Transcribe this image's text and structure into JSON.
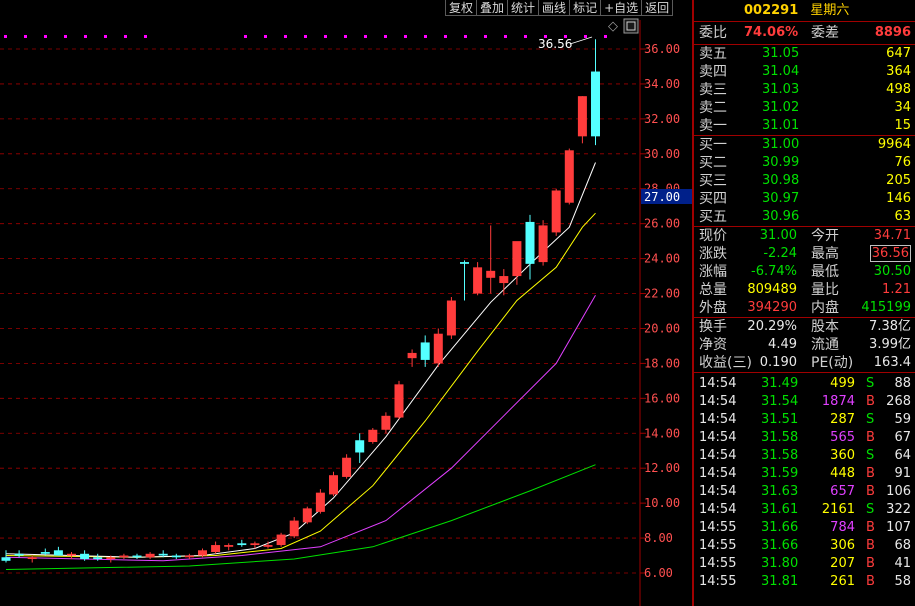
{
  "toolbar": {
    "buttons": [
      "复权",
      "叠加",
      "统计",
      "画线",
      "标记",
      "+自选",
      "返回"
    ]
  },
  "header": {
    "code": "002291",
    "name": "星期六"
  },
  "price_axis": {
    "ticks": [
      "36.00",
      "34.00",
      "32.00",
      "30.00",
      "28.00",
      "26.00",
      "24.00",
      "22.00",
      "20.00",
      "18.00",
      "16.00",
      "14.00",
      "12.00",
      "10.00",
      "8.00",
      "6.00"
    ],
    "current_price_tag": "27.00"
  },
  "chart_annotation": {
    "high_label": "36.56",
    "marker": "◇"
  },
  "colors": {
    "up": "#ff3c3c",
    "down": "#54ffff",
    "ma5": "#ffffff",
    "ma10": "#ffff00",
    "ma20": "#e040ff",
    "ma60": "#00e000",
    "grid": "#a00000"
  },
  "quote": {
    "weibi_label": "委比",
    "weibi_value": "74.06%",
    "weicha_label": "委差",
    "weicha_value": "8896",
    "asks": [
      {
        "label": "卖五",
        "price": "31.05",
        "vol": "647"
      },
      {
        "label": "卖四",
        "price": "31.04",
        "vol": "364"
      },
      {
        "label": "卖三",
        "price": "31.03",
        "vol": "498"
      },
      {
        "label": "卖二",
        "price": "31.02",
        "vol": "34"
      },
      {
        "label": "卖一",
        "price": "31.01",
        "vol": "15"
      }
    ],
    "bids": [
      {
        "label": "买一",
        "price": "31.00",
        "vol": "9964"
      },
      {
        "label": "买二",
        "price": "30.99",
        "vol": "76"
      },
      {
        "label": "买三",
        "price": "30.98",
        "vol": "205"
      },
      {
        "label": "买四",
        "price": "30.97",
        "vol": "146"
      },
      {
        "label": "买五",
        "price": "30.96",
        "vol": "63"
      }
    ],
    "stats": [
      {
        "l1": "现价",
        "v1": "31.00",
        "l2": "今开",
        "v2": "34.71"
      },
      {
        "l1": "涨跌",
        "v1": "-2.24",
        "l2": "最高",
        "v2": "36.56"
      },
      {
        "l1": "涨幅",
        "v1": "-6.74%",
        "l2": "最低",
        "v2": "30.50"
      },
      {
        "l1": "总量",
        "v1": "809489",
        "l2": "量比",
        "v2": "1.21"
      },
      {
        "l1": "外盘",
        "v1": "394290",
        "l2": "内盘",
        "v2": "415199"
      }
    ],
    "fund": [
      {
        "l1": "换手",
        "v1": "20.29%",
        "l2": "股本",
        "v2": "7.38亿"
      },
      {
        "l1": "净资",
        "v1": "4.49",
        "l2": "流通",
        "v2": "3.99亿"
      },
      {
        "l1": "收益(三)",
        "v1": "0.190",
        "l2": "PE(动)",
        "v2": "163.4"
      }
    ]
  },
  "ticks": [
    {
      "time": "14:54",
      "price": "31.49",
      "vol": "499",
      "side": "S",
      "count": "88"
    },
    {
      "time": "14:54",
      "price": "31.54",
      "vol": "1874",
      "side": "B",
      "count": "268"
    },
    {
      "time": "14:54",
      "price": "31.51",
      "vol": "287",
      "side": "S",
      "count": "59"
    },
    {
      "time": "14:54",
      "price": "31.58",
      "vol": "565",
      "side": "B",
      "count": "67"
    },
    {
      "time": "14:54",
      "price": "31.58",
      "vol": "360",
      "side": "S",
      "count": "64"
    },
    {
      "time": "14:54",
      "price": "31.59",
      "vol": "448",
      "side": "B",
      "count": "91"
    },
    {
      "time": "14:54",
      "price": "31.63",
      "vol": "657",
      "side": "B",
      "count": "106"
    },
    {
      "time": "14:54",
      "price": "31.61",
      "vol": "2161",
      "side": "S",
      "count": "322"
    },
    {
      "time": "14:55",
      "price": "31.66",
      "vol": "784",
      "side": "B",
      "count": "107"
    },
    {
      "time": "14:55",
      "price": "31.66",
      "vol": "306",
      "side": "B",
      "count": "68"
    },
    {
      "time": "14:55",
      "price": "31.80",
      "vol": "207",
      "side": "B",
      "count": "41"
    },
    {
      "time": "14:55",
      "price": "31.81",
      "vol": "261",
      "side": "B",
      "count": "58"
    }
  ],
  "chart_data": {
    "type": "candlestick",
    "ylim": [
      5.5,
      38
    ],
    "candles": [
      {
        "o": 6.9,
        "h": 7.3,
        "l": 6.6,
        "c": 6.7
      },
      {
        "o": 7.1,
        "h": 7.3,
        "l": 6.9,
        "c": 7.0
      },
      {
        "o": 6.8,
        "h": 7.0,
        "l": 6.6,
        "c": 6.9
      },
      {
        "o": 7.2,
        "h": 7.4,
        "l": 7.0,
        "c": 7.1
      },
      {
        "o": 7.3,
        "h": 7.5,
        "l": 7.0,
        "c": 7.0
      },
      {
        "o": 7.0,
        "h": 7.2,
        "l": 6.8,
        "c": 7.1
      },
      {
        "o": 7.1,
        "h": 7.3,
        "l": 6.7,
        "c": 6.8
      },
      {
        "o": 6.9,
        "h": 7.1,
        "l": 6.7,
        "c": 6.8
      },
      {
        "o": 6.8,
        "h": 7.0,
        "l": 6.6,
        "c": 6.9
      },
      {
        "o": 6.9,
        "h": 7.1,
        "l": 6.8,
        "c": 7.0
      },
      {
        "o": 7.0,
        "h": 7.1,
        "l": 6.8,
        "c": 6.9
      },
      {
        "o": 6.9,
        "h": 7.2,
        "l": 6.8,
        "c": 7.1
      },
      {
        "o": 7.1,
        "h": 7.3,
        "l": 6.9,
        "c": 7.0
      },
      {
        "o": 7.0,
        "h": 7.1,
        "l": 6.8,
        "c": 6.9
      },
      {
        "o": 6.9,
        "h": 7.1,
        "l": 6.8,
        "c": 7.0
      },
      {
        "o": 7.0,
        "h": 7.4,
        "l": 6.9,
        "c": 7.3
      },
      {
        "o": 7.2,
        "h": 7.8,
        "l": 7.1,
        "c": 7.6
      },
      {
        "o": 7.5,
        "h": 7.7,
        "l": 7.3,
        "c": 7.6
      },
      {
        "o": 7.7,
        "h": 7.9,
        "l": 7.5,
        "c": 7.6
      },
      {
        "o": 7.6,
        "h": 7.8,
        "l": 7.4,
        "c": 7.7
      },
      {
        "o": 7.5,
        "h": 7.8,
        "l": 7.4,
        "c": 7.6
      },
      {
        "o": 7.6,
        "h": 8.3,
        "l": 7.5,
        "c": 8.2
      },
      {
        "o": 8.1,
        "h": 9.2,
        "l": 8.0,
        "c": 9.0
      },
      {
        "o": 8.9,
        "h": 9.8,
        "l": 8.8,
        "c": 9.7
      },
      {
        "o": 9.5,
        "h": 10.8,
        "l": 9.4,
        "c": 10.6
      },
      {
        "o": 10.5,
        "h": 11.8,
        "l": 10.4,
        "c": 11.6
      },
      {
        "o": 11.5,
        "h": 12.8,
        "l": 11.4,
        "c": 12.6
      },
      {
        "o": 13.6,
        "h": 14.0,
        "l": 12.3,
        "c": 12.9
      },
      {
        "o": 13.5,
        "h": 14.3,
        "l": 13.4,
        "c": 14.2
      },
      {
        "o": 14.2,
        "h": 15.2,
        "l": 14.0,
        "c": 15.0
      },
      {
        "o": 14.9,
        "h": 17.0,
        "l": 14.8,
        "c": 16.8
      },
      {
        "o": 18.3,
        "h": 18.8,
        "l": 17.8,
        "c": 18.6
      },
      {
        "o": 19.2,
        "h": 19.6,
        "l": 17.8,
        "c": 18.2
      },
      {
        "o": 18.0,
        "h": 20.0,
        "l": 17.8,
        "c": 19.7
      },
      {
        "o": 19.6,
        "h": 21.8,
        "l": 19.4,
        "c": 21.6
      },
      {
        "o": 23.8,
        "h": 23.9,
        "l": 21.6,
        "c": 23.7
      },
      {
        "o": 22.0,
        "h": 23.8,
        "l": 21.9,
        "c": 23.5
      },
      {
        "o": 22.9,
        "h": 25.9,
        "l": 22.0,
        "c": 23.3
      },
      {
        "o": 22.6,
        "h": 23.4,
        "l": 21.9,
        "c": 23.0
      },
      {
        "o": 23.0,
        "h": 24.8,
        "l": 22.5,
        "c": 25.0
      },
      {
        "o": 26.1,
        "h": 26.5,
        "l": 22.8,
        "c": 23.7
      },
      {
        "o": 23.8,
        "h": 26.2,
        "l": 23.6,
        "c": 25.9
      },
      {
        "o": 25.5,
        "h": 28.0,
        "l": 25.3,
        "c": 27.9
      },
      {
        "o": 27.2,
        "h": 30.3,
        "l": 27.1,
        "c": 30.2
      },
      {
        "o": 31.0,
        "h": 33.3,
        "l": 30.6,
        "c": 33.3
      },
      {
        "o": 34.71,
        "h": 36.56,
        "l": 30.5,
        "c": 31.0
      }
    ],
    "ma5": [
      [
        0,
        7.1
      ],
      [
        10,
        6.9
      ],
      [
        15,
        7.0
      ],
      [
        19,
        7.4
      ],
      [
        22,
        8.3
      ],
      [
        25,
        10.3
      ],
      [
        29,
        13.8
      ],
      [
        33,
        17.9
      ],
      [
        37,
        21.5
      ],
      [
        41,
        24.4
      ],
      [
        43,
        25.8
      ],
      [
        45,
        29.5
      ]
    ],
    "ma10": [
      [
        0,
        7.0
      ],
      [
        10,
        6.9
      ],
      [
        16,
        7.0
      ],
      [
        21,
        7.4
      ],
      [
        24,
        8.4
      ],
      [
        28,
        11.0
      ],
      [
        32,
        14.7
      ],
      [
        36,
        18.7
      ],
      [
        39,
        21.6
      ],
      [
        42,
        23.5
      ],
      [
        44,
        25.8
      ],
      [
        45,
        26.6
      ]
    ],
    "ma20": [
      [
        0,
        6.9
      ],
      [
        12,
        6.7
      ],
      [
        18,
        7.0
      ],
      [
        24,
        7.5
      ],
      [
        29,
        9.0
      ],
      [
        34,
        12.0
      ],
      [
        38,
        15.0
      ],
      [
        42,
        18.0
      ],
      [
        45,
        21.9
      ]
    ],
    "ma60": [
      [
        0,
        6.2
      ],
      [
        14,
        6.4
      ],
      [
        22,
        6.8
      ],
      [
        28,
        7.5
      ],
      [
        34,
        9.0
      ],
      [
        40,
        10.7
      ],
      [
        45,
        12.2
      ]
    ]
  }
}
